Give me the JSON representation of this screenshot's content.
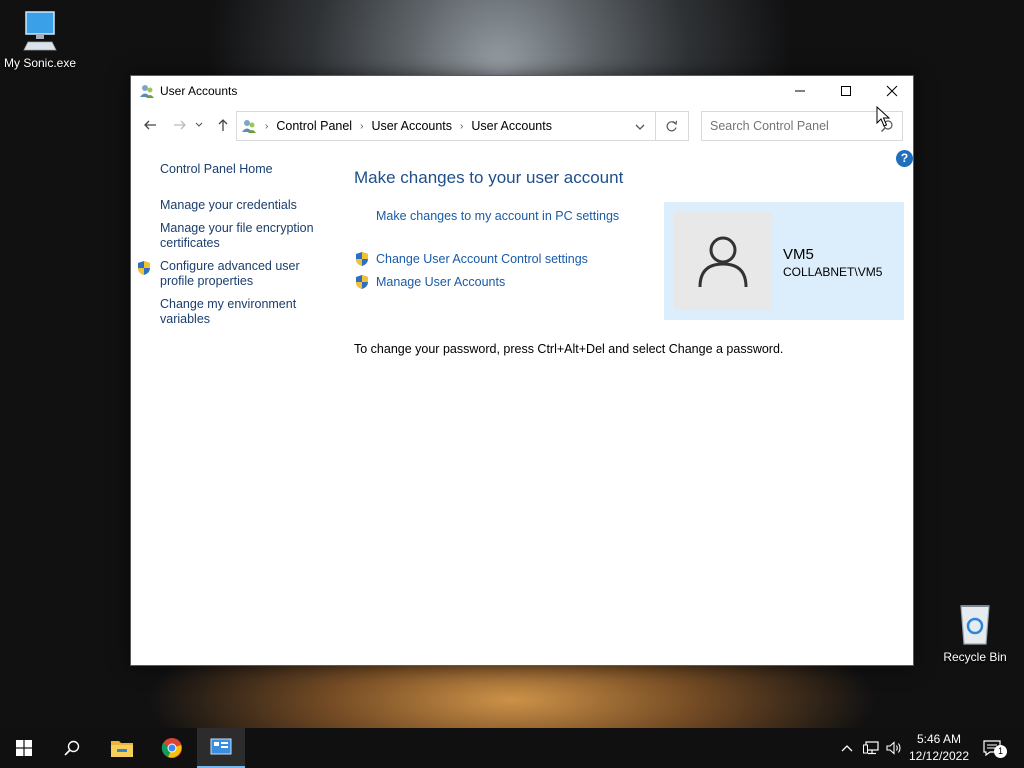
{
  "desktop": {
    "icons": [
      {
        "label": "My Sonic.exe",
        "icon": "computer-icon"
      },
      {
        "label": "Recycle Bin",
        "icon": "recycle-bin-icon"
      }
    ]
  },
  "window": {
    "title": "User Accounts",
    "breadcrumb": [
      "Control Panel",
      "User Accounts",
      "User Accounts"
    ],
    "search_placeholder": "Search Control Panel",
    "help": "?"
  },
  "sidebar": {
    "items": [
      {
        "label": "Control Panel Home",
        "shield": false
      },
      {
        "label": "Manage your credentials",
        "shield": false
      },
      {
        "label": "Manage your file encryption certificates",
        "shield": false
      },
      {
        "label": "Configure advanced user profile properties",
        "shield": true
      },
      {
        "label": "Change my environment variables",
        "shield": false
      }
    ]
  },
  "main": {
    "heading": "Make changes to your user account",
    "link_pc_settings": "Make changes to my account in PC settings",
    "link_uac": "Change User Account Control settings",
    "link_manage": "Manage User Accounts",
    "password_note": "To change your password, press Ctrl+Alt+Del and select Change a password."
  },
  "user": {
    "name": "VM5",
    "domain_account": "COLLABNET\\VM5"
  },
  "taskbar": {
    "time": "5:46 AM",
    "date": "12/12/2022",
    "notification_count": "1"
  },
  "colors": {
    "link": "#1a5ba6",
    "heading": "#1e4e8c",
    "user_card_bg": "#dceefb",
    "taskbar_bg": "#101010"
  }
}
